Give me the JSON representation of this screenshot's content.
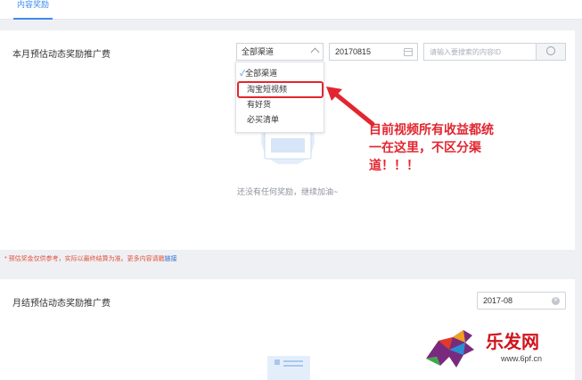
{
  "tabs": {
    "active_label": "内容奖励"
  },
  "section1": {
    "title": "本月预估动态奖励推广费",
    "channel_select": {
      "selected": "全部渠道",
      "icon": "chevron-up-icon"
    },
    "date_field": {
      "value": "20170815",
      "icon": "calendar-icon"
    },
    "search": {
      "placeholder": "请输入要搜索的内容ID",
      "icon": "search-icon"
    },
    "dropdown": {
      "items": [
        {
          "label": "全部渠道",
          "checked": true
        },
        {
          "label": "淘宝短视频",
          "checked": false
        },
        {
          "label": "有好货",
          "checked": false
        },
        {
          "label": "必买清单",
          "checked": false
        }
      ]
    },
    "empty_message": "还没有任何奖励，继续加油~",
    "note_text": "* 预估奖金仅供参考，实际以最终结算为准。更多内容请戳",
    "note_link": "链接"
  },
  "annotation": {
    "lines": [
      "目前视频所有收益都统",
      "一在这里，不区分渠",
      "道！！！"
    ],
    "color": "#e2262f"
  },
  "section2": {
    "title": "月结预估动态奖励推广费",
    "month_field": {
      "value": "2017-08",
      "icon": "clear-icon"
    }
  },
  "watermark": {
    "brand": "乐发网",
    "url": "www.6pf.cn"
  },
  "colors": {
    "accent": "#3d8bf2",
    "highlight": "#e2262f"
  }
}
